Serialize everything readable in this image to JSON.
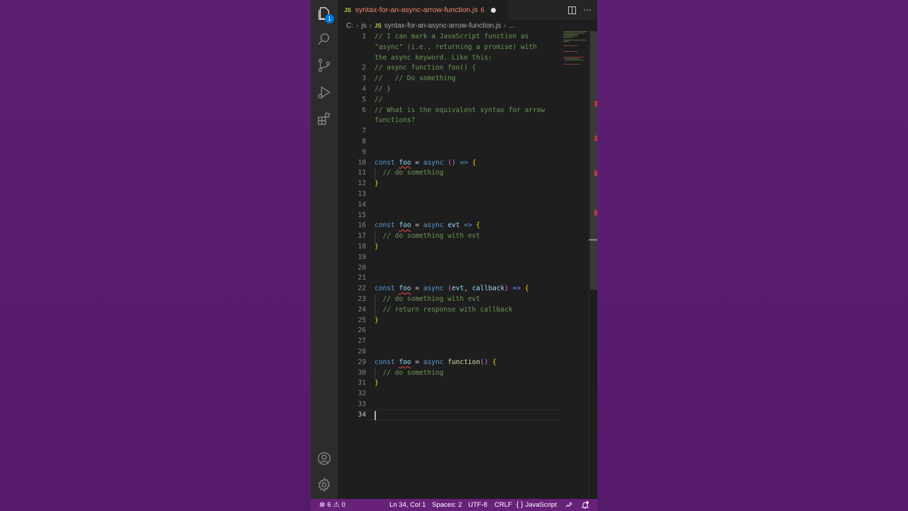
{
  "tab": {
    "lang_badge": "JS",
    "filename": "syntax-for-an-async-arrow-function.js",
    "problem_count": "6"
  },
  "breadcrumb": {
    "drive": "C:",
    "folder": "js",
    "lang_badge": "JS",
    "file": "syntax-for-an-async-arrow-function.js",
    "ellipsis": "..."
  },
  "activity": {
    "explorer_badge": "1"
  },
  "editor": {
    "current_line": "34",
    "lines": [
      {
        "n": "1",
        "text": "// I can mark a JavaScript function as"
      },
      {
        "n": "",
        "text": "\"async\" (i.e., returning a promise) with"
      },
      {
        "n": "",
        "text": "the async keyword. Like this:"
      },
      {
        "n": "2",
        "text": "// async function foo() {"
      },
      {
        "n": "3",
        "text": "//   // Do something"
      },
      {
        "n": "4",
        "text": "// }"
      },
      {
        "n": "5",
        "text": "//"
      },
      {
        "n": "6",
        "text": "// What is the equivalent syntax for arrow"
      },
      {
        "n": "",
        "text": "functions?"
      },
      {
        "n": "7",
        "text": ""
      },
      {
        "n": "8",
        "text": ""
      },
      {
        "n": "9",
        "text": ""
      },
      {
        "n": "10",
        "text": "const foo = async () => {"
      },
      {
        "n": "11",
        "text": "  // do something"
      },
      {
        "n": "12",
        "text": "}"
      },
      {
        "n": "13",
        "text": ""
      },
      {
        "n": "14",
        "text": ""
      },
      {
        "n": "15",
        "text": ""
      },
      {
        "n": "16",
        "text": "const foo = async evt => {"
      },
      {
        "n": "17",
        "text": "  // do something with evt"
      },
      {
        "n": "18",
        "text": "}"
      },
      {
        "n": "19",
        "text": ""
      },
      {
        "n": "20",
        "text": ""
      },
      {
        "n": "21",
        "text": ""
      },
      {
        "n": "22",
        "text": "const foo = async (evt, callback) => {"
      },
      {
        "n": "23",
        "text": "  // do something with evt"
      },
      {
        "n": "24",
        "text": "  // return response with callback"
      },
      {
        "n": "25",
        "text": "}"
      },
      {
        "n": "26",
        "text": ""
      },
      {
        "n": "27",
        "text": ""
      },
      {
        "n": "28",
        "text": ""
      },
      {
        "n": "29",
        "text": "const foo = async function() {"
      },
      {
        "n": "30",
        "text": "  // do something"
      },
      {
        "n": "31",
        "text": "}"
      },
      {
        "n": "32",
        "text": ""
      },
      {
        "n": "33",
        "text": ""
      },
      {
        "n": "34",
        "text": ""
      }
    ]
  },
  "statusbar": {
    "errors": "6",
    "warnings": "0",
    "position": "Ln 34, Col 1",
    "spaces": "Spaces: 2",
    "encoding": "UTF-8",
    "eol": "CRLF",
    "language": "JavaScript",
    "lang_icon": "{ }"
  },
  "colors": {
    "accent_status": "#68217a",
    "comment": "#6a9955",
    "keyword": "#569cd6",
    "variable": "#9cdcfe",
    "function": "#dcdcaa",
    "error": "#f48771"
  }
}
